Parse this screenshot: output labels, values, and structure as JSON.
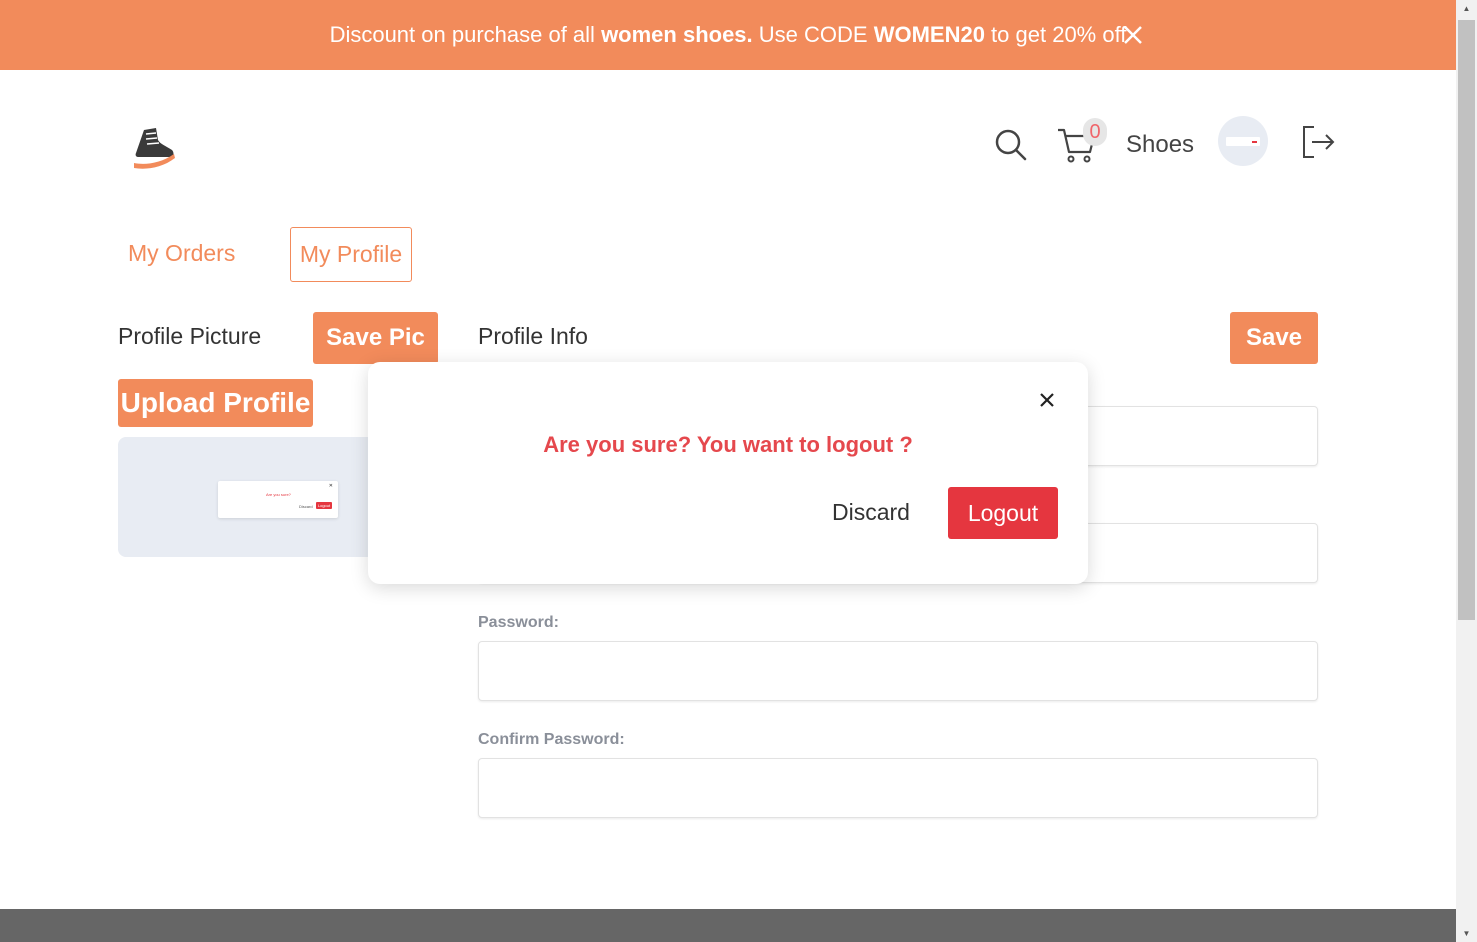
{
  "banner": {
    "text_1": "Discount on purchase of all ",
    "bold_1": "women shoes.",
    "text_2": " Use CODE ",
    "bold_2": "WOMEN20",
    "text_3": " to get 20% off"
  },
  "header": {
    "cart_count": "0",
    "brand_label": "Shoes"
  },
  "tabs": {
    "orders": "My Orders",
    "profile": "My Profile"
  },
  "profile_picture": {
    "title": "Profile Picture",
    "save_pic_label": "Save Pic",
    "upload_label": "Upload Profile"
  },
  "profile_info": {
    "title": "Profile Info",
    "save_label": "Save",
    "password_label": "Password:",
    "confirm_password_label": "Confirm Password:"
  },
  "modal": {
    "message": "Are you sure? You want to logout ?",
    "discard_label": "Discard",
    "logout_label": "Logout"
  },
  "preview_thumbnail": {
    "message": "Are you sure?",
    "discard_label": "Discard",
    "logout_label": "Logout"
  },
  "colors": {
    "accent": "#f28b5b",
    "danger": "#e5363f",
    "footer": "#666666"
  }
}
